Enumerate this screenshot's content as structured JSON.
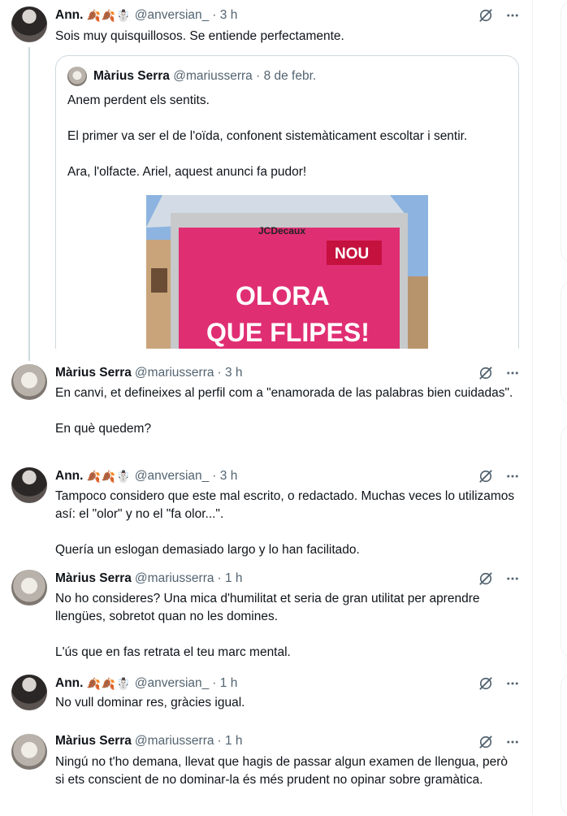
{
  "tweets": [
    {
      "name": "Ann.",
      "emoji": "🍂🍂☃️",
      "handle": "@anversian_",
      "time": "· 3 h",
      "text": "Sois muy quisquillosos. Se entiende perfectamente."
    },
    {
      "name": "Màrius Serra",
      "emoji": "",
      "handle": "@mariusserra",
      "time": "· 3 h",
      "text": "En canvi, et defineixes al perfil com a \"enamorada de las palabras bien cuidadas\".\n\nEn què quedem?"
    },
    {
      "name": "Ann.",
      "emoji": "🍂🍂☃️",
      "handle": "@anversian_",
      "time": "· 3 h",
      "text": "Tampoco considero que este mal escrito, o redactado. Muchas veces lo utilizamos así: el \"olor\" y no el \"fa olor...\".\n\nQuería un eslogan demasiado largo y lo han facilitado."
    },
    {
      "name": "Màrius Serra",
      "emoji": "",
      "handle": "@mariusserra",
      "time": "· 1 h",
      "text": "No ho consideres? Una mica d'humilitat et seria de gran utilitat per aprendre llengües, sobretot quan no les domines.\n\nL'ús que en fas retrata el teu marc mental."
    },
    {
      "name": "Ann.",
      "emoji": "🍂🍂☃️",
      "handle": "@anversian_",
      "time": "· 1 h",
      "text": "No vull dominar res, gràcies igual."
    },
    {
      "name": "Màrius Serra",
      "emoji": "",
      "handle": "@mariusserra",
      "time": "· 1 h",
      "text": "Ningú no t'ho demana, llevat que hagis de passar algun examen de llengua, però si ets conscient de no dominar-la és més prudent no opinar sobre gramàtica."
    }
  ],
  "quote": {
    "name": "Màrius Serra",
    "handle": "@mariusserra",
    "time": "· 8 de febr.",
    "text": "Anem perdent els sentits.\n\nEl primer va ser el de l'oïda, confonent sistemàticament escoltar i sentir.\n\nAra, l'olfacte. Ariel, aquest anunci fa pudor!",
    "image": {
      "brand": "JCDecaux",
      "badge": "NOU",
      "line1": "OLORA",
      "line2": "QUE FLIPES!"
    }
  },
  "colors": {
    "text": "#0f1419",
    "muted": "#536471",
    "border": "#cfd9de",
    "poster_pink": "#d6246a"
  },
  "icons": [
    "grok-icon",
    "more-icon"
  ]
}
